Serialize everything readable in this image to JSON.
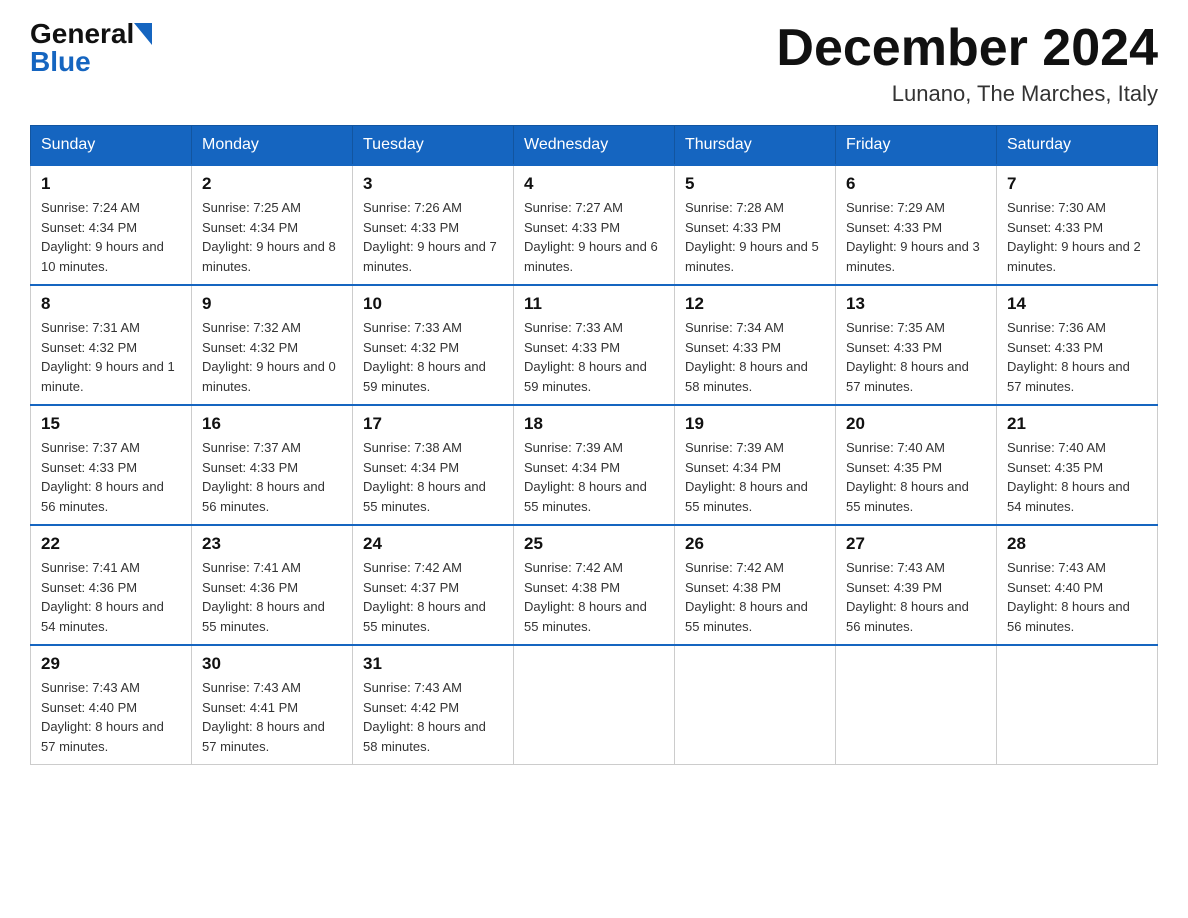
{
  "header": {
    "logo_general": "General",
    "logo_blue": "Blue",
    "month_title": "December 2024",
    "location": "Lunano, The Marches, Italy"
  },
  "weekdays": [
    "Sunday",
    "Monday",
    "Tuesday",
    "Wednesday",
    "Thursday",
    "Friday",
    "Saturday"
  ],
  "weeks": [
    [
      {
        "day": "1",
        "sunrise": "7:24 AM",
        "sunset": "4:34 PM",
        "daylight": "9 hours and 10 minutes."
      },
      {
        "day": "2",
        "sunrise": "7:25 AM",
        "sunset": "4:34 PM",
        "daylight": "9 hours and 8 minutes."
      },
      {
        "day": "3",
        "sunrise": "7:26 AM",
        "sunset": "4:33 PM",
        "daylight": "9 hours and 7 minutes."
      },
      {
        "day": "4",
        "sunrise": "7:27 AM",
        "sunset": "4:33 PM",
        "daylight": "9 hours and 6 minutes."
      },
      {
        "day": "5",
        "sunrise": "7:28 AM",
        "sunset": "4:33 PM",
        "daylight": "9 hours and 5 minutes."
      },
      {
        "day": "6",
        "sunrise": "7:29 AM",
        "sunset": "4:33 PM",
        "daylight": "9 hours and 3 minutes."
      },
      {
        "day": "7",
        "sunrise": "7:30 AM",
        "sunset": "4:33 PM",
        "daylight": "9 hours and 2 minutes."
      }
    ],
    [
      {
        "day": "8",
        "sunrise": "7:31 AM",
        "sunset": "4:32 PM",
        "daylight": "9 hours and 1 minute."
      },
      {
        "day": "9",
        "sunrise": "7:32 AM",
        "sunset": "4:32 PM",
        "daylight": "9 hours and 0 minutes."
      },
      {
        "day": "10",
        "sunrise": "7:33 AM",
        "sunset": "4:32 PM",
        "daylight": "8 hours and 59 minutes."
      },
      {
        "day": "11",
        "sunrise": "7:33 AM",
        "sunset": "4:33 PM",
        "daylight": "8 hours and 59 minutes."
      },
      {
        "day": "12",
        "sunrise": "7:34 AM",
        "sunset": "4:33 PM",
        "daylight": "8 hours and 58 minutes."
      },
      {
        "day": "13",
        "sunrise": "7:35 AM",
        "sunset": "4:33 PM",
        "daylight": "8 hours and 57 minutes."
      },
      {
        "day": "14",
        "sunrise": "7:36 AM",
        "sunset": "4:33 PM",
        "daylight": "8 hours and 57 minutes."
      }
    ],
    [
      {
        "day": "15",
        "sunrise": "7:37 AM",
        "sunset": "4:33 PM",
        "daylight": "8 hours and 56 minutes."
      },
      {
        "day": "16",
        "sunrise": "7:37 AM",
        "sunset": "4:33 PM",
        "daylight": "8 hours and 56 minutes."
      },
      {
        "day": "17",
        "sunrise": "7:38 AM",
        "sunset": "4:34 PM",
        "daylight": "8 hours and 55 minutes."
      },
      {
        "day": "18",
        "sunrise": "7:39 AM",
        "sunset": "4:34 PM",
        "daylight": "8 hours and 55 minutes."
      },
      {
        "day": "19",
        "sunrise": "7:39 AM",
        "sunset": "4:34 PM",
        "daylight": "8 hours and 55 minutes."
      },
      {
        "day": "20",
        "sunrise": "7:40 AM",
        "sunset": "4:35 PM",
        "daylight": "8 hours and 55 minutes."
      },
      {
        "day": "21",
        "sunrise": "7:40 AM",
        "sunset": "4:35 PM",
        "daylight": "8 hours and 54 minutes."
      }
    ],
    [
      {
        "day": "22",
        "sunrise": "7:41 AM",
        "sunset": "4:36 PM",
        "daylight": "8 hours and 54 minutes."
      },
      {
        "day": "23",
        "sunrise": "7:41 AM",
        "sunset": "4:36 PM",
        "daylight": "8 hours and 55 minutes."
      },
      {
        "day": "24",
        "sunrise": "7:42 AM",
        "sunset": "4:37 PM",
        "daylight": "8 hours and 55 minutes."
      },
      {
        "day": "25",
        "sunrise": "7:42 AM",
        "sunset": "4:38 PM",
        "daylight": "8 hours and 55 minutes."
      },
      {
        "day": "26",
        "sunrise": "7:42 AM",
        "sunset": "4:38 PM",
        "daylight": "8 hours and 55 minutes."
      },
      {
        "day": "27",
        "sunrise": "7:43 AM",
        "sunset": "4:39 PM",
        "daylight": "8 hours and 56 minutes."
      },
      {
        "day": "28",
        "sunrise": "7:43 AM",
        "sunset": "4:40 PM",
        "daylight": "8 hours and 56 minutes."
      }
    ],
    [
      {
        "day": "29",
        "sunrise": "7:43 AM",
        "sunset": "4:40 PM",
        "daylight": "8 hours and 57 minutes."
      },
      {
        "day": "30",
        "sunrise": "7:43 AM",
        "sunset": "4:41 PM",
        "daylight": "8 hours and 57 minutes."
      },
      {
        "day": "31",
        "sunrise": "7:43 AM",
        "sunset": "4:42 PM",
        "daylight": "8 hours and 58 minutes."
      },
      null,
      null,
      null,
      null
    ]
  ],
  "labels": {
    "sunrise": "Sunrise:",
    "sunset": "Sunset:",
    "daylight": "Daylight:"
  }
}
